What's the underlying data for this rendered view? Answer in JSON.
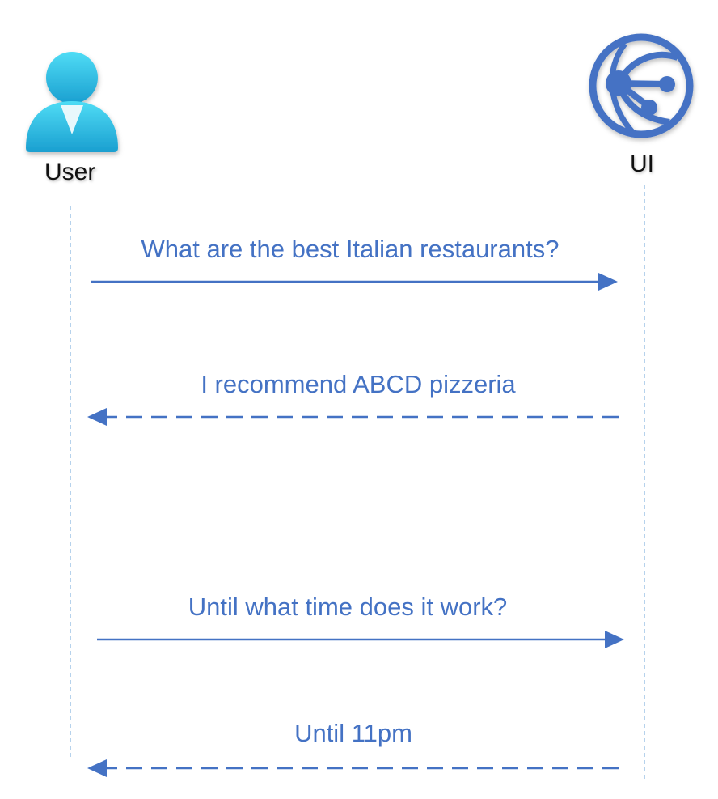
{
  "actors": {
    "user": {
      "label": "User",
      "icon": "user-icon"
    },
    "ui": {
      "label": "UI",
      "icon": "web-globe-icon"
    }
  },
  "messages": [
    {
      "text": "What are the best Italian restaurants?",
      "from": "user",
      "to": "ui",
      "style": "solid"
    },
    {
      "text": "I recommend ABCD pizzeria",
      "from": "ui",
      "to": "user",
      "style": "dashed"
    },
    {
      "text": "Until what time does it work?",
      "from": "user",
      "to": "ui",
      "style": "solid"
    },
    {
      "text": "Until 11pm",
      "from": "ui",
      "to": "user",
      "style": "dashed"
    }
  ],
  "colors": {
    "arrow": "#4472c4",
    "lifeline": "#9dc3e6",
    "user_icon": "#36c5ea",
    "globe_icon": "#4472c4"
  }
}
